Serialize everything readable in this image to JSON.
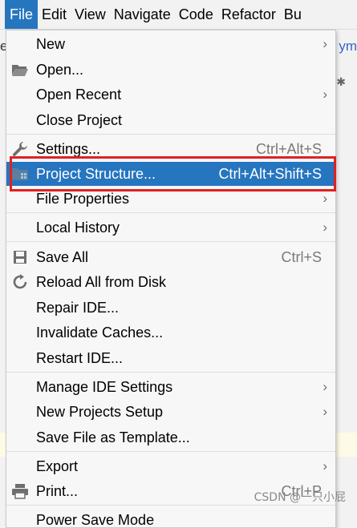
{
  "menubar": {
    "items": [
      {
        "label": "File",
        "mnemonic_hint": "F",
        "active": true
      },
      {
        "label": "Edit"
      },
      {
        "label": "View"
      },
      {
        "label": "Navigate"
      },
      {
        "label": "Code"
      },
      {
        "label": "Refactor"
      },
      {
        "label": "Bu"
      }
    ]
  },
  "background": {
    "left_fragment": "er",
    "right_fragment": "ym"
  },
  "file_menu": {
    "items": [
      {
        "label": "New",
        "submenu": true,
        "icon": null
      },
      {
        "label": "Open...",
        "icon": "folder-open-icon"
      },
      {
        "label": "Open Recent",
        "submenu": true
      },
      {
        "label": "Close Project"
      },
      {
        "label": "Settings...",
        "shortcut": "Ctrl+Alt+S",
        "icon": "wrench-icon"
      },
      {
        "label": "Project Structure...",
        "shortcut": "Ctrl+Alt+Shift+S",
        "icon": "project-structure-icon",
        "selected": true
      },
      {
        "label": "File Properties",
        "submenu": true
      },
      {
        "label": "Local History",
        "submenu": true
      },
      {
        "label": "Save All",
        "shortcut": "Ctrl+S",
        "icon": "save-icon"
      },
      {
        "label": "Reload All from Disk",
        "icon": "reload-icon"
      },
      {
        "label": "Repair IDE..."
      },
      {
        "label": "Invalidate Caches..."
      },
      {
        "label": "Restart IDE..."
      },
      {
        "label": "Manage IDE Settings",
        "submenu": true
      },
      {
        "label": "New Projects Setup",
        "submenu": true
      },
      {
        "label": "Save File as Template..."
      },
      {
        "label": "Export",
        "submenu": true
      },
      {
        "label": "Print...",
        "shortcut": "Ctrl+P",
        "icon": "printer-icon"
      },
      {
        "label": "Power Save Mode"
      }
    ]
  },
  "watermark": "CSDN @一只小屁",
  "colors": {
    "selection": "#2675bf",
    "highlight_box": "#e02020"
  }
}
